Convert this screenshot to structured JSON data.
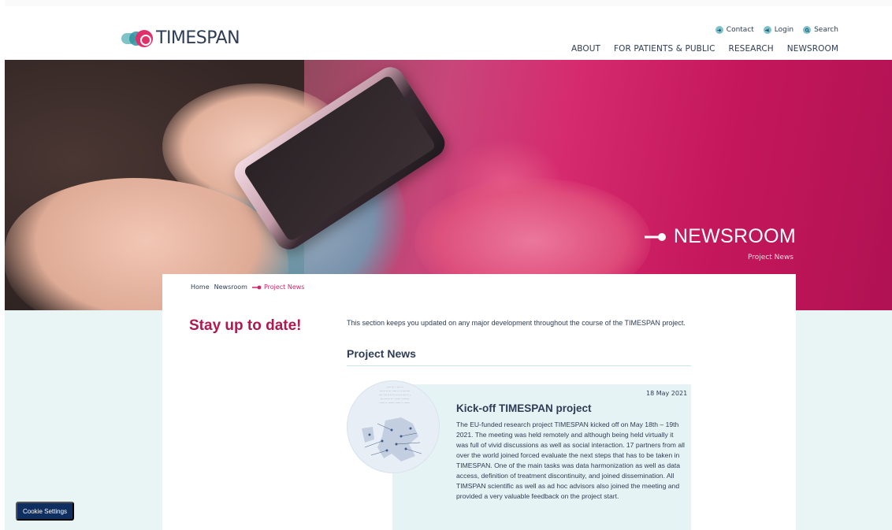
{
  "brand": {
    "name": "TIMESPAN"
  },
  "utility_nav": [
    {
      "label": "Contact",
      "icon": "arrow-circle-icon"
    },
    {
      "label": "Login",
      "icon": "login-icon"
    },
    {
      "label": "Search",
      "icon": "search-icon"
    }
  ],
  "main_nav": [
    "ABOUT",
    "FOR PATIENTS & PUBLIC",
    "RESEARCH",
    "NEWSROOM"
  ],
  "hero": {
    "title": "NEWSROOM",
    "subtitle": "Project News"
  },
  "breadcrumb": [
    "Home",
    "Newsroom",
    "Project News"
  ],
  "sidebar_heading": "Stay up to date!",
  "intro": "This section keeps you updated on any major development throughout the course of the TIMESPAN project.",
  "section_heading": "Project News",
  "news": {
    "date": "18 May 2021",
    "title": "Kick-off TIMESPAN project",
    "body": "The EU-funded research project TIMESPAN kicked off on May 18th – 19th 2021. The meeting was held remotely and although being held virtually it was full of vivid discussions as well as social interaction. 17 partners from all over the world joined forced evaluate the next steps that has to be taken in TIMESPAN. One of the main tasks was data harmonization as well as data access, definition of treatment discontinuity, and joined dissemination. All TIMSPAN scientific as well as ad hoc advisors also joined the meeting and provided a very valuable feedback on the project start."
  },
  "cookie_button": "Cookie Settings",
  "colors": {
    "accent": "#d1246b",
    "brand_dark": "#2e3d55",
    "teal_light": "#e9f4f5",
    "cookie_bg": "#0f2f60"
  }
}
